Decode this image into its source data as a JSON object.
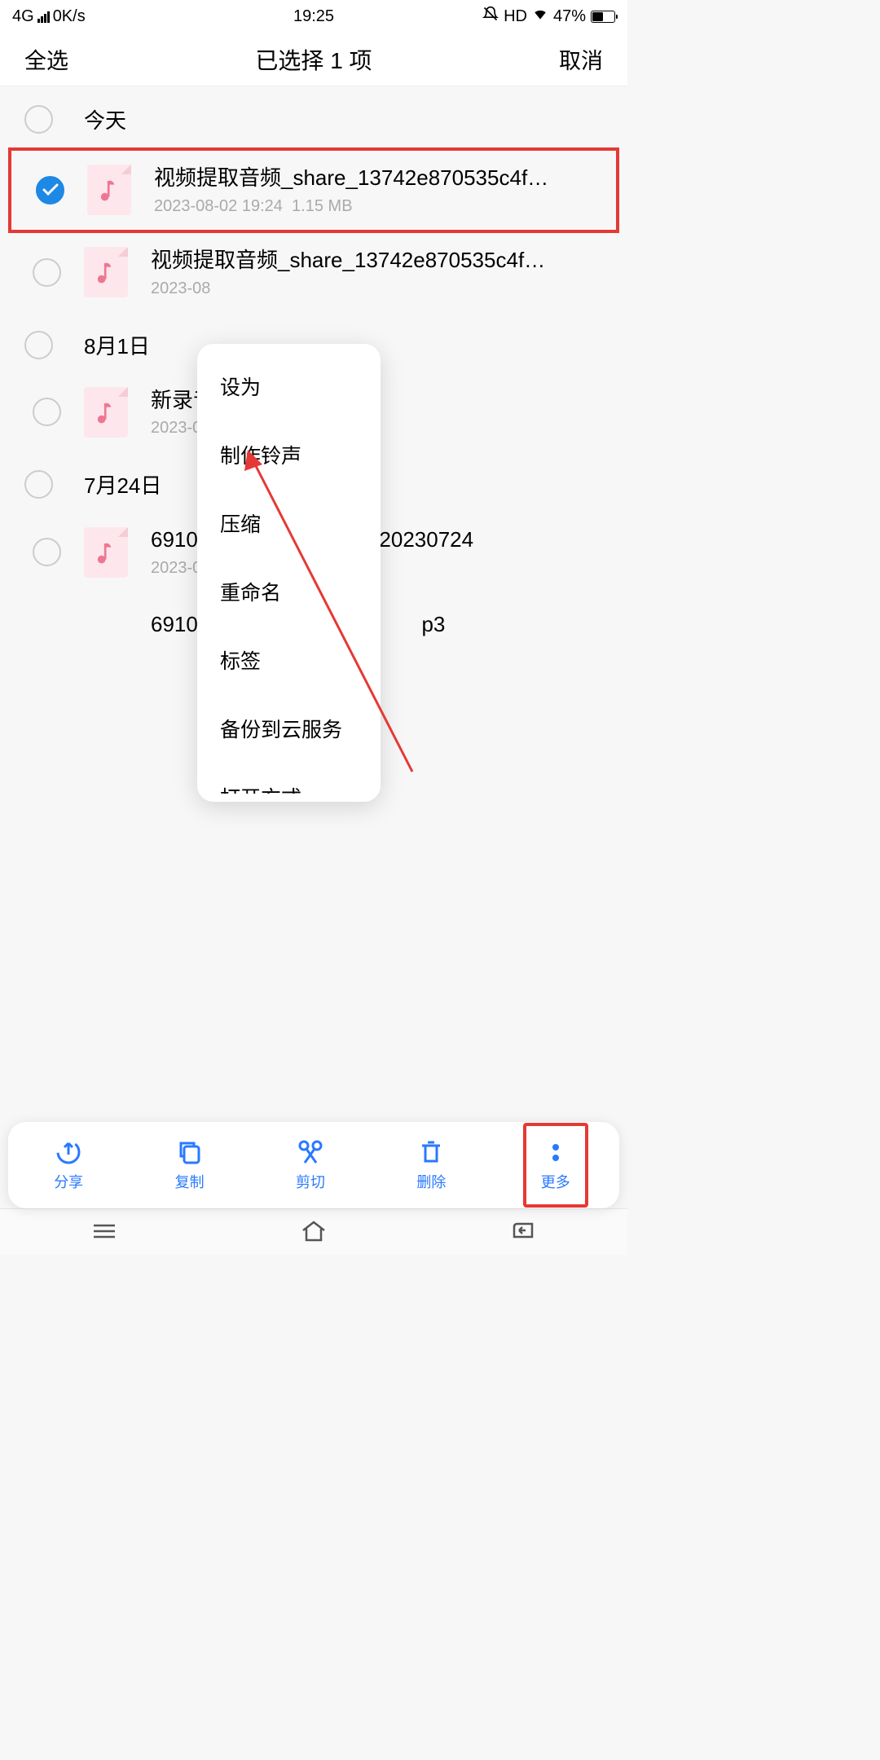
{
  "status_bar": {
    "network": "4G",
    "speed": "0K/s",
    "time": "19:25",
    "hd": "HD",
    "battery": "47%"
  },
  "top_bar": {
    "select_all": "全选",
    "title": "已选择 1 项",
    "cancel": "取消"
  },
  "sections": [
    {
      "title": "今天",
      "items": [
        {
          "name": "视频提取音频_share_13742e870535c4f…",
          "date": "2023-08-02 19:24",
          "size": "1.15 MB",
          "selected": true,
          "highlighted": true
        },
        {
          "name": "视频提取音频_share_13742e870535c4f…",
          "date": "2023-08",
          "size": "",
          "selected": false
        }
      ]
    },
    {
      "title": "8月1日",
      "items": [
        {
          "name": "新录音",
          "date": "2023-08",
          "size": ""
        }
      ]
    },
    {
      "title": "7月24日",
      "items": [
        {
          "name": "69104​​​​​​​​​​​​​20230724",
          "name_prefix": "69104",
          "name_suffix": "20230724",
          "date": "2023-07",
          "size": ""
        },
        {
          "name_prefix": "69104",
          "name_suffix": "p3",
          "date": "",
          "size": ""
        }
      ]
    }
  ],
  "popup": {
    "items": [
      "设为",
      "制作铃声",
      "压缩",
      "重命名",
      "标签",
      "备份到云服务",
      "打开方式"
    ]
  },
  "bottom_bar": {
    "share": "分享",
    "copy": "复制",
    "cut": "剪切",
    "delete": "删除",
    "more": "更多"
  }
}
